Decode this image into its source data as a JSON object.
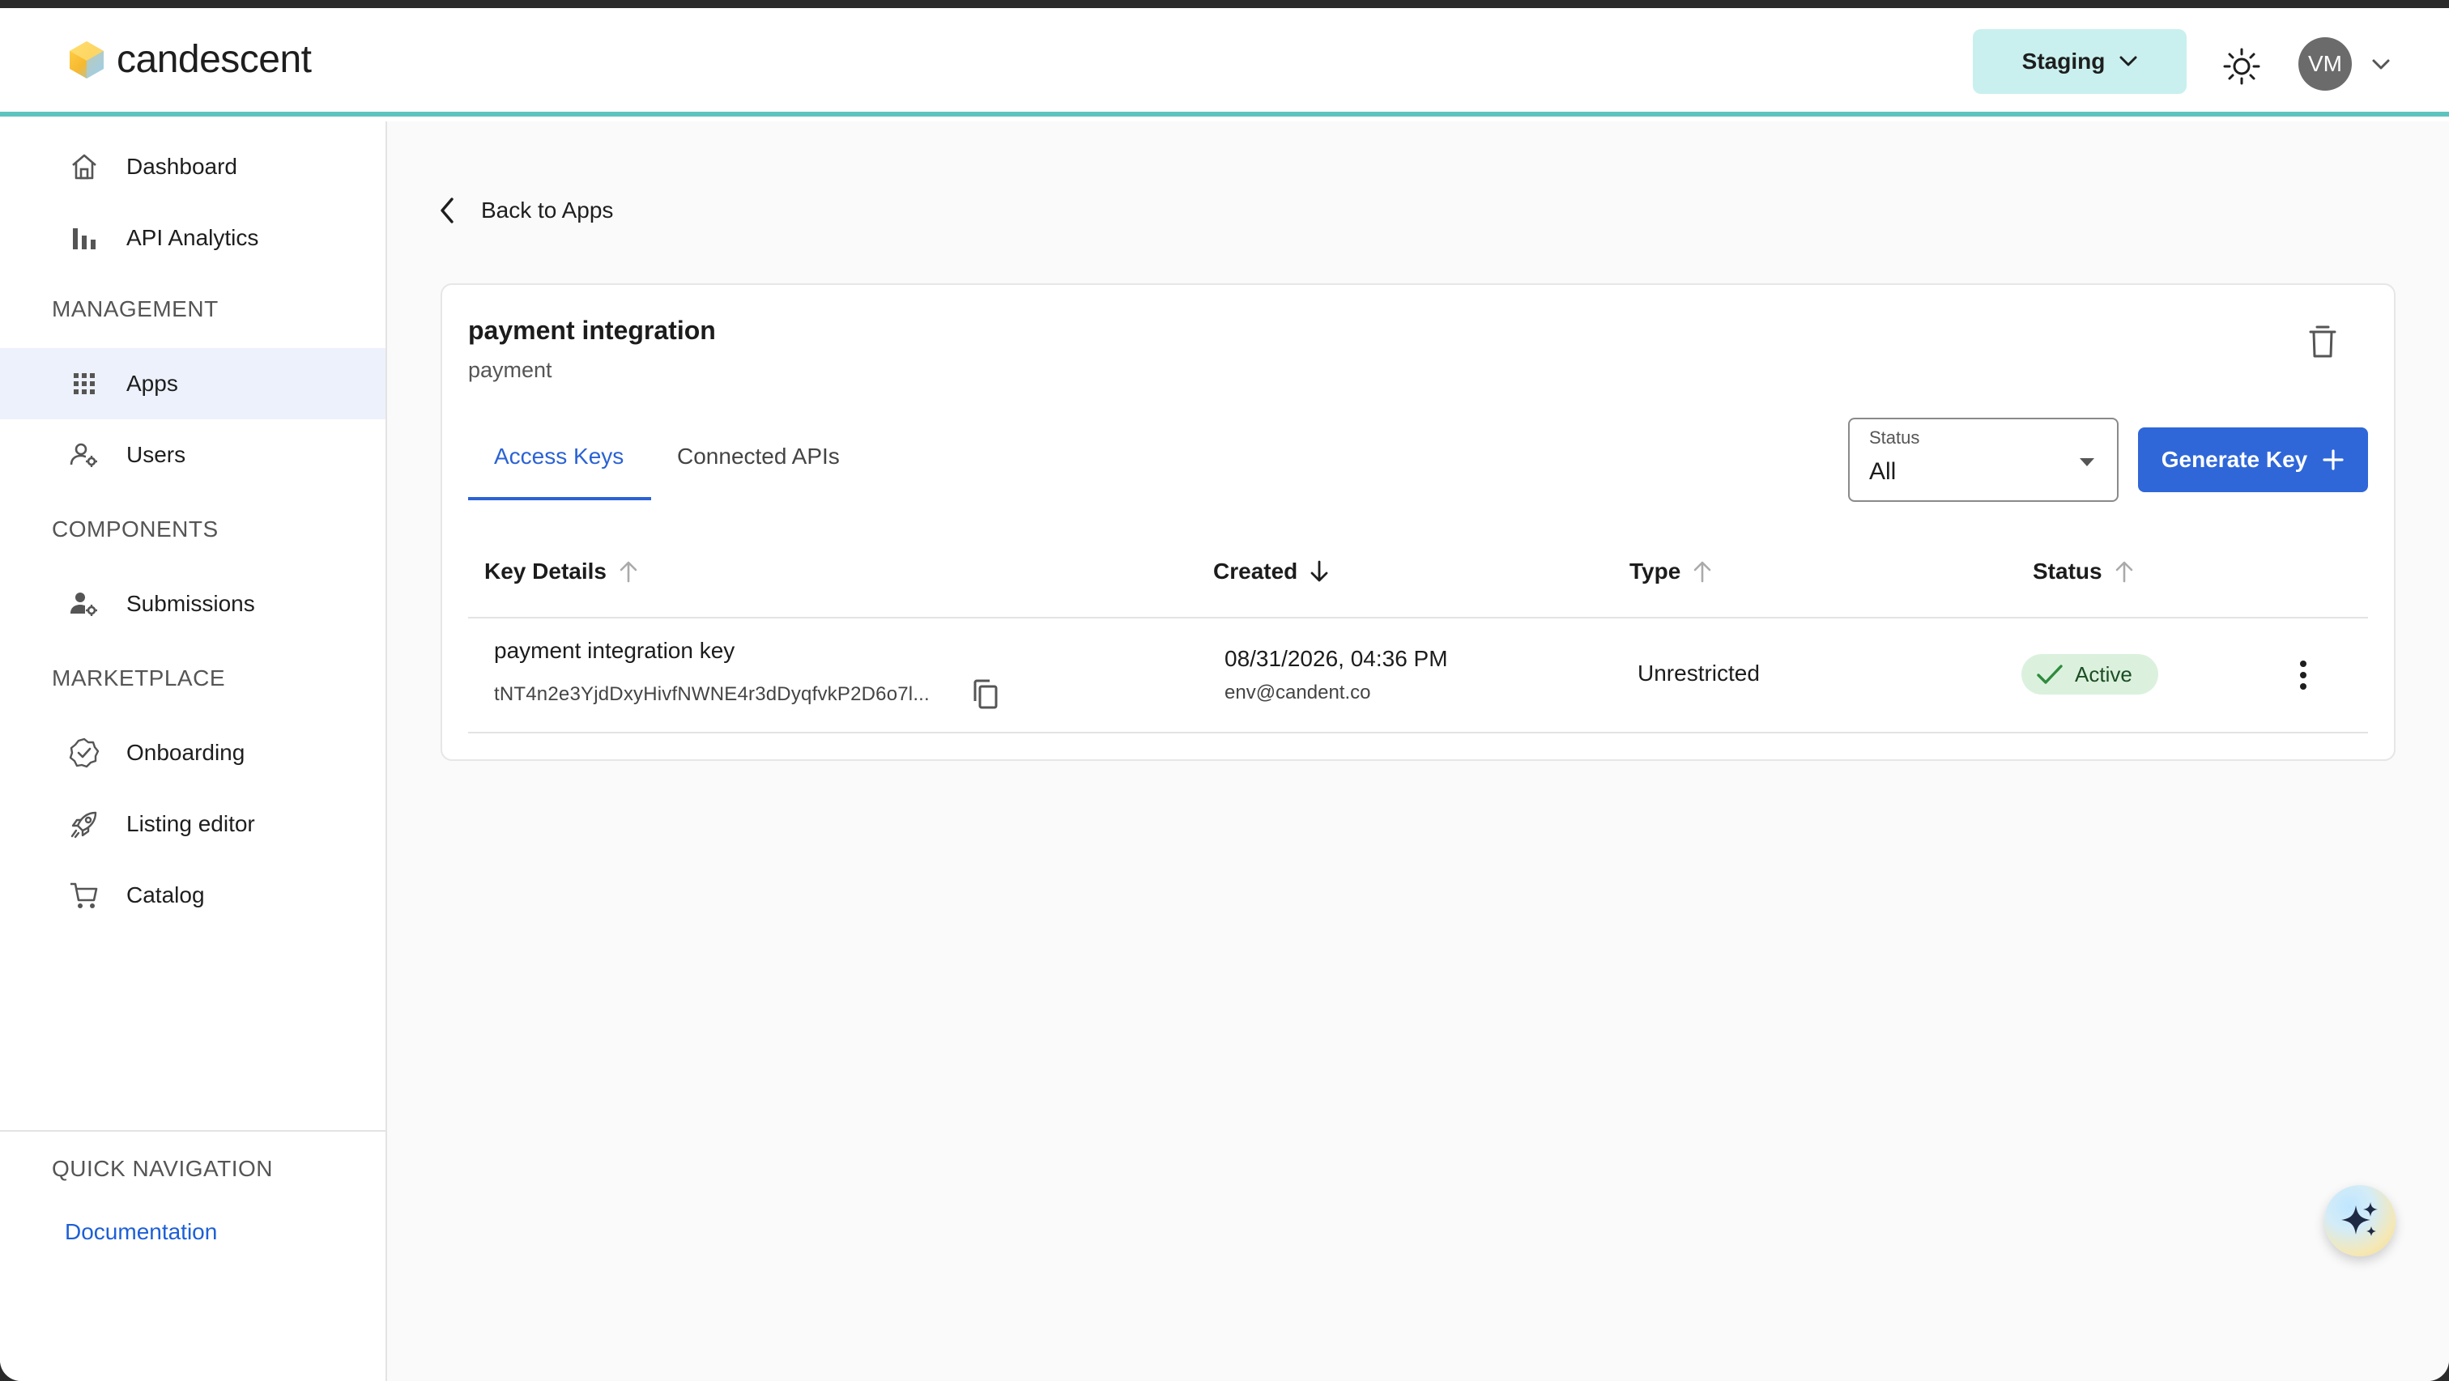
{
  "header": {
    "brand": "candescent",
    "environment": "Staging",
    "user_initials": "VM"
  },
  "sidebar": {
    "items_top": [
      {
        "label": "Dashboard",
        "icon": "home-icon"
      },
      {
        "label": "API Analytics",
        "icon": "bar-chart-icon"
      }
    ],
    "management_label": "MANAGEMENT",
    "management_items": [
      {
        "label": "Apps",
        "icon": "grid-icon",
        "active": true
      },
      {
        "label": "Users",
        "icon": "user-settings-icon"
      }
    ],
    "components_label": "COMPONENTS",
    "components_items": [
      {
        "label": "Submissions",
        "icon": "user-gear-icon"
      }
    ],
    "marketplace_label": "MARKETPLACE",
    "marketplace_items": [
      {
        "label": "Onboarding",
        "icon": "verified-badge-icon"
      },
      {
        "label": "Listing editor",
        "icon": "rocket-icon"
      },
      {
        "label": "Catalog",
        "icon": "cart-icon"
      }
    ],
    "quick_nav_label": "QUICK NAVIGATION",
    "documentation_link": "Documentation"
  },
  "main": {
    "back_label": "Back to Apps",
    "app_title": "payment integration",
    "app_subtitle": "payment",
    "tabs": [
      {
        "label": "Access Keys",
        "active": true
      },
      {
        "label": "Connected APIs",
        "active": false
      }
    ],
    "status_filter": {
      "label": "Status",
      "value": "All"
    },
    "generate_button": "Generate Key",
    "table": {
      "columns": [
        "Key Details",
        "Created",
        "Type",
        "Status"
      ],
      "rows": [
        {
          "key_name": "payment integration key",
          "key_token": "tNT4n2e3YjdDxyHivfNWNE4r3dDyqfvkP2D6o7l...",
          "created_date": "08/31/2026, 04:36 PM",
          "created_by": "env@candent.co",
          "type": "Unrestricted",
          "status": "Active"
        }
      ]
    }
  },
  "colors": {
    "accent": "#2f67d8",
    "header_border": "#5ec3bf",
    "env_button_bg": "#c9f0ee",
    "active_badge_bg": "#dbf1dd",
    "link": "#1d5fd6"
  }
}
